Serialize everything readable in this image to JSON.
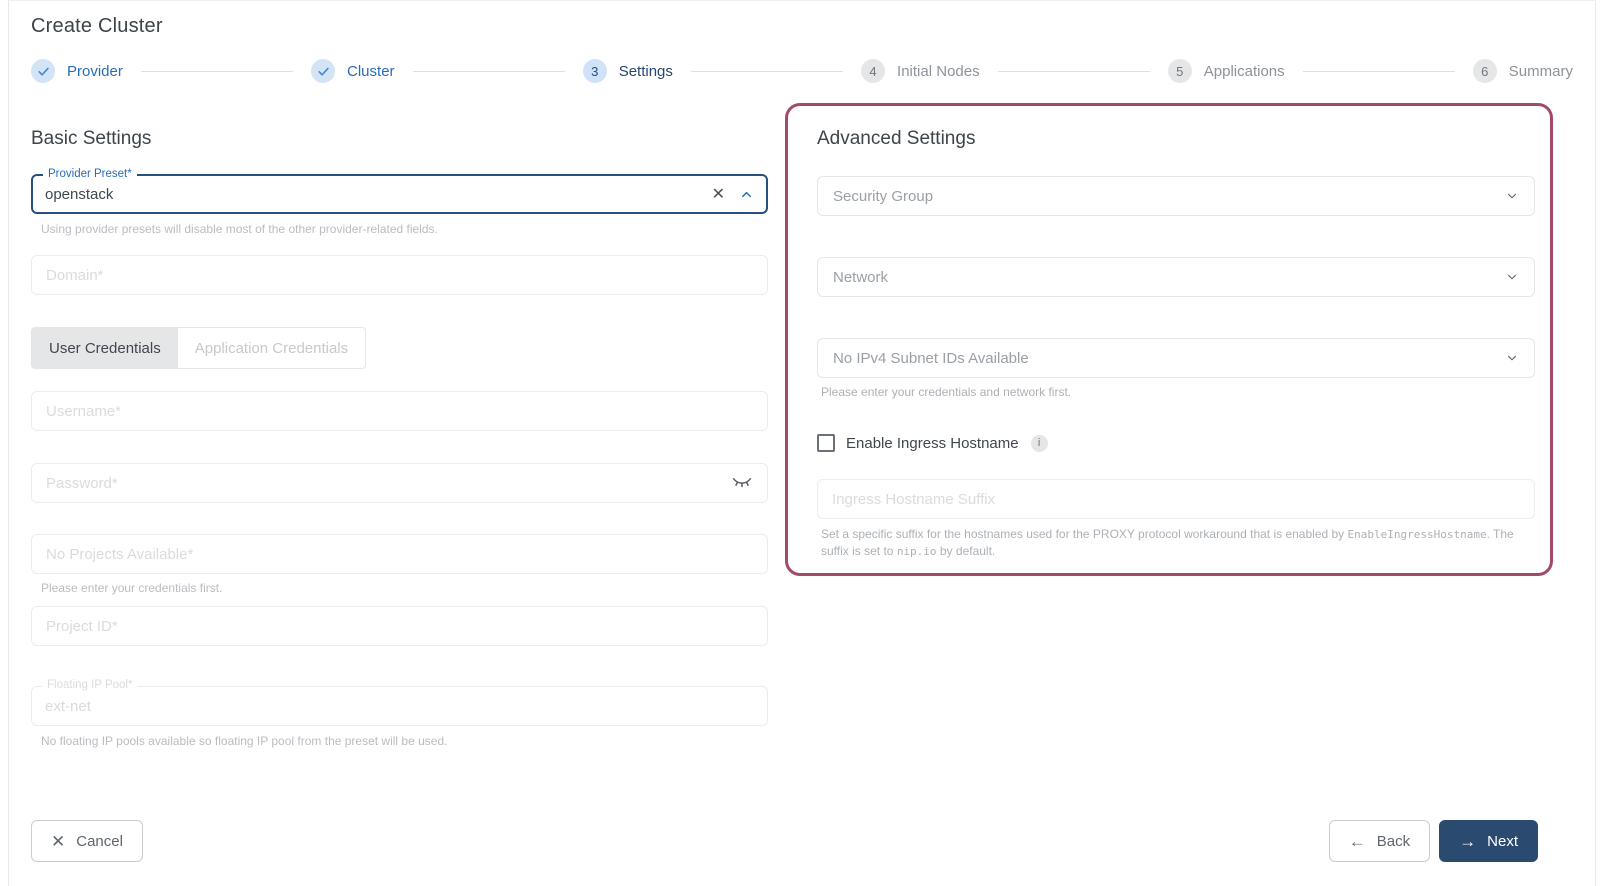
{
  "page": {
    "title": "Create Cluster"
  },
  "stepper": {
    "steps": [
      {
        "label": "Provider",
        "state": "done"
      },
      {
        "label": "Cluster",
        "state": "done"
      },
      {
        "label": "Settings",
        "number": "3",
        "state": "active"
      },
      {
        "label": "Initial Nodes",
        "number": "4",
        "state": "todo"
      },
      {
        "label": "Applications",
        "number": "5",
        "state": "todo"
      },
      {
        "label": "Summary",
        "number": "6",
        "state": "todo"
      }
    ]
  },
  "basic": {
    "heading": "Basic Settings",
    "provider_preset": {
      "label": "Provider Preset*",
      "value": "openstack",
      "helper": "Using provider presets will disable most of the other provider-related fields."
    },
    "domain": {
      "placeholder": "Domain*"
    },
    "tabs": [
      {
        "label": "User Credentials",
        "selected": true
      },
      {
        "label": "Application Credentials",
        "selected": false
      }
    ],
    "username": {
      "placeholder": "Username*"
    },
    "password": {
      "placeholder": "Password*"
    },
    "projects": {
      "placeholder": "No Projects Available*",
      "helper": "Please enter your credentials first."
    },
    "project_id": {
      "placeholder": "Project ID*"
    },
    "floating_ip_pool": {
      "label": "Floating IP Pool*",
      "value": "ext-net",
      "helper": "No floating IP pools available so floating IP pool from the preset will be used."
    }
  },
  "advanced": {
    "heading": "Advanced Settings",
    "security_group": {
      "placeholder": "Security Group"
    },
    "network": {
      "placeholder": "Network"
    },
    "subnet": {
      "placeholder": "No IPv4 Subnet IDs Available",
      "helper": "Please enter your credentials and network first."
    },
    "enable_ingress": {
      "label": "Enable Ingress Hostname",
      "checked": false
    },
    "ingress_suffix": {
      "placeholder": "Ingress Hostname Suffix",
      "helper_part1": "Set a specific suffix for the hostnames used for the PROXY protocol workaround that is enabled by ",
      "helper_code1": "EnableIngressHostname",
      "helper_part2": ". The suffix is set to ",
      "helper_code2": "nip.io",
      "helper_part3": " by default."
    }
  },
  "footer": {
    "cancel": "Cancel",
    "back": "Back",
    "next": "Next"
  },
  "icons": {
    "clear": "✕",
    "cancel": "✕",
    "back_arrow": "←",
    "next_arrow": "→",
    "info": "i"
  },
  "colors": {
    "accent_blue": "#2a6cb8",
    "active_field_border": "#26507f",
    "highlight_maroon": "#a34a67",
    "primary_button": "#2b4a70",
    "step_done_bg": "#d4e4f7",
    "step_todo_bg": "#e4e6e8"
  }
}
